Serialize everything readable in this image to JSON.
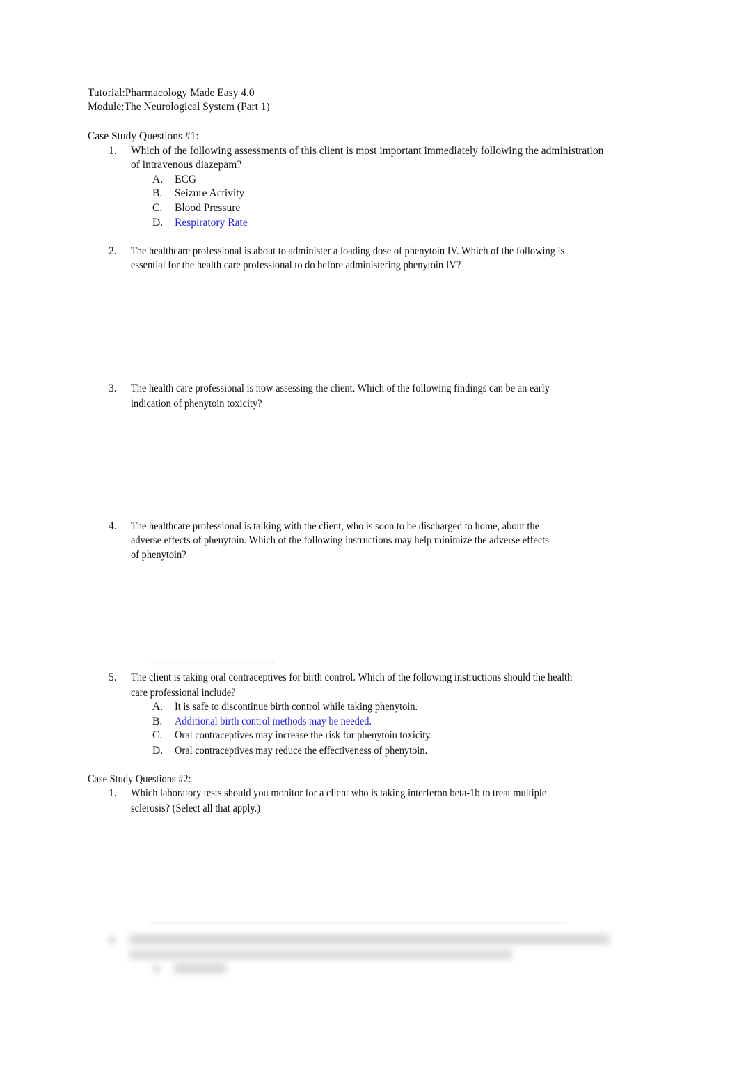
{
  "header": {
    "tutorial": "Tutorial:Pharmacology Made Easy 4.0",
    "module": "Module:The Neurological System (Part 1)"
  },
  "section1": {
    "title": "Case Study Questions #1:",
    "questions": [
      {
        "number": "1.",
        "lines": [
          "Which of the following assessments of this client is most important immediately following the administration",
          "of intravenous diazepam?"
        ],
        "options": [
          {
            "letter": "A.",
            "text": "ECG",
            "highlighted": false
          },
          {
            "letter": "B.",
            "text": "Seizure Activity",
            "highlighted": false
          },
          {
            "letter": "C.",
            "text": "Blood Pressure",
            "highlighted": false
          },
          {
            "letter": "D.",
            "text": "Respiratory Rate",
            "highlighted": true
          }
        ]
      },
      {
        "number": "2.",
        "lines": [
          "The healthcare professional is about to administer a loading dose of phenytoin IV. Which of the following is",
          "essential for the health care professional to do before administering phenytoin IV?"
        ]
      },
      {
        "number": "3.",
        "lines": [
          "The health care professional is now assessing the client. Which of the following findings can be an early",
          "indication of phenytoin toxicity?"
        ]
      },
      {
        "number": "4.",
        "lines": [
          "The healthcare professional is talking with the client, who is soon to be discharged to home, about the",
          "adverse effects of phenytoin. Which of the following instructions may help minimize the adverse effects",
          "of phenytoin?"
        ]
      },
      {
        "number": "5.",
        "lines": [
          "The client is taking oral contraceptives for birth control. Which of the following instructions should the health",
          "care professional include?"
        ],
        "options": [
          {
            "letter": "A.",
            "text": "It is safe to discontinue birth control while taking phenytoin.",
            "highlighted": false
          },
          {
            "letter": "B.",
            "text": "Additional birth control methods may be needed.",
            "highlighted": true
          },
          {
            "letter": "C.",
            "text": "Oral contraceptives may increase the risk for phenytoin toxicity.",
            "highlighted": false
          },
          {
            "letter": "D.",
            "text": "Oral contraceptives may reduce the effectiveness of phenytoin.",
            "highlighted": false
          }
        ]
      }
    ]
  },
  "section2": {
    "title": "Case Study Questions #2:",
    "questions": [
      {
        "number": "1.",
        "lines": [
          "Which laboratory tests should you monitor for a client who is taking interferon beta-1b to treat multiple",
          "sclerosis? (Select all that apply.)"
        ]
      }
    ]
  },
  "colors": {
    "answer_highlight": "#1f1fe6",
    "text": "#111111"
  }
}
